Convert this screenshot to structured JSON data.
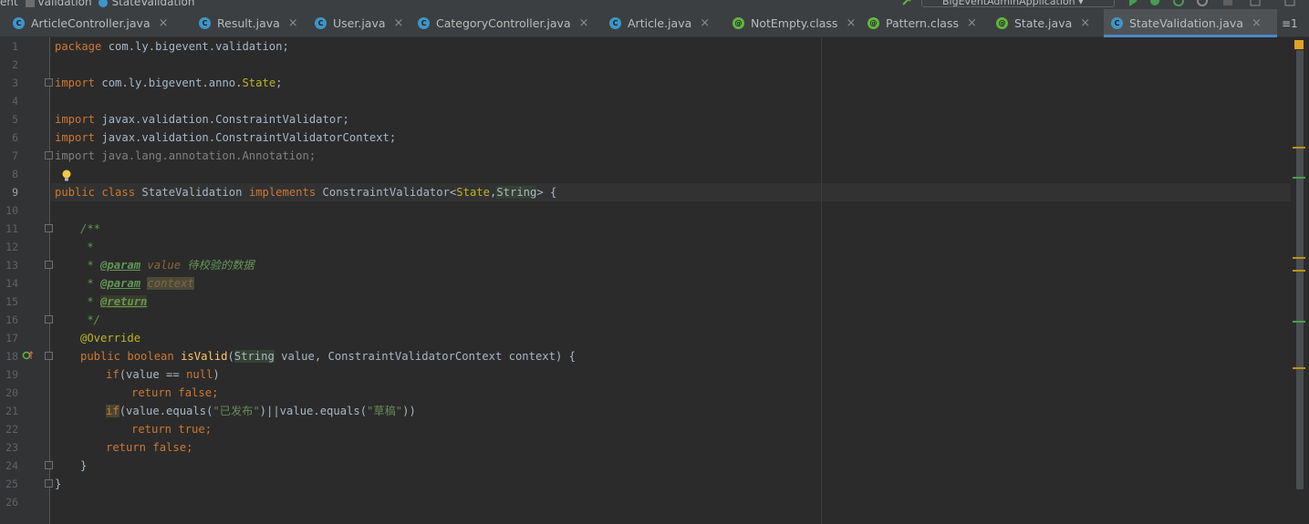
{
  "breadcrumb": {
    "items": [
      "ent",
      "validation",
      "StateValidation"
    ]
  },
  "toolbar": {
    "run_config": "BigEventAdminApplication"
  },
  "tabs": [
    {
      "label": "ArticleController.java",
      "kind": "class"
    },
    {
      "label": "Result.java",
      "kind": "class"
    },
    {
      "label": "User.java",
      "kind": "class"
    },
    {
      "label": "CategoryController.java",
      "kind": "class"
    },
    {
      "label": "Article.java",
      "kind": "class"
    },
    {
      "label": "NotEmpty.class",
      "kind": "annotation"
    },
    {
      "label": "Pattern.class",
      "kind": "annotation"
    },
    {
      "label": "State.java",
      "kind": "annotation"
    },
    {
      "label": "StateValidation.java",
      "kind": "class",
      "active": true
    }
  ],
  "tabs_overflow": "≡1",
  "editor": {
    "current_line": 9,
    "line_numbers": [
      "1",
      "2",
      "3",
      "4",
      "5",
      "6",
      "7",
      "8",
      "9",
      "10",
      "11",
      "12",
      "13",
      "14",
      "15",
      "16",
      "17",
      "18",
      "19",
      "20",
      "21",
      "22",
      "23",
      "24",
      "25",
      "26"
    ],
    "code": {
      "l1_kw": "package",
      "l1_rest": " com.ly.bigevent.validation;",
      "l3_kw": "import",
      "l3_rest": " com.ly.bigevent.anno.",
      "l3_ref": "State",
      "l3_end": ";",
      "l5_kw": "import",
      "l5_rest": " javax.validation.ConstraintValidator;",
      "l6_kw": "import",
      "l6_rest": " javax.validation.ConstraintValidatorContext;",
      "l7": "import java.lang.annotation.Annotation;",
      "l9_kw1": "public class",
      "l9_name": " StateValidation ",
      "l9_kw2": "implements",
      "l9_iface": " ConstraintValidator<",
      "l9_t1": "State",
      "l9_comma": ",",
      "l9_t2": "String",
      "l9_end": "> {",
      "l11": "/**",
      "l12": " *",
      "l13_star": " * ",
      "l13_tag": "@param",
      "l13_param": "value",
      "l13_desc": " 待校验的数据",
      "l14_star": " * ",
      "l14_tag": "@param",
      "l14_param": "context",
      "l15_star": " * ",
      "l15_tag": "@return",
      "l16": " */",
      "l17": "@Override",
      "l18_kw": "public boolean ",
      "l18_fn": "isValid",
      "l18_open": "(",
      "l18_type": "String",
      "l18_rest": " value, ConstraintValidatorContext context) {",
      "l19_kw": "if",
      "l19_rest": "(value == ",
      "l19_null": "null",
      "l19_end": ")",
      "l20_kw": "return false",
      "l20_end": ";",
      "l21_kw": "if",
      "l21_a": "(value.equals(",
      "l21_s1": "\"已发布\"",
      "l21_b": ")||value.equals(",
      "l21_s2": "\"草稿\"",
      "l21_c": "))",
      "l22_kw": "return true",
      "l22_end": ";",
      "l23_kw": "return false",
      "l23_end": ";",
      "l24": "}",
      "l25": "}"
    }
  },
  "colors": {
    "background": "#2b2b2b",
    "keyword": "#cc7832",
    "string": "#6a8759",
    "annotation": "#bbb529",
    "method": "#ffc66d",
    "doc_comment": "#629755",
    "active_tab_underline": "#4a88c7"
  }
}
